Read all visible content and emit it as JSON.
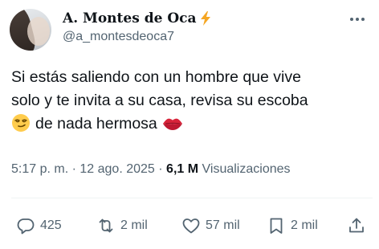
{
  "author": {
    "display_name": "A. Montes de Oca",
    "handle": "@a_montesdeoca7",
    "badge_icon": "lightning-bolt-icon",
    "badge_color": "#f5a623"
  },
  "tweet": {
    "line1": "Si estás saliendo con un hombre que vive",
    "line2": "solo y te invita a su casa, revisa su escoba",
    "line3": "de nada hermosa",
    "emoji_before_line3": "smirking-face-emoji",
    "emoji_after_line3": "kiss-mark-emoji"
  },
  "meta": {
    "time": "5:17 p. m.",
    "separator": "·",
    "date": "12 ago. 2025",
    "views_count": "6,1 M",
    "views_label": "Visualizaciones"
  },
  "actions": {
    "replies": "425",
    "reposts": "2 mil",
    "likes": "57 mil",
    "bookmarks": "2 mil"
  },
  "colors": {
    "text": "#0f1419",
    "secondary": "#536471",
    "divider": "#eff3f4"
  }
}
